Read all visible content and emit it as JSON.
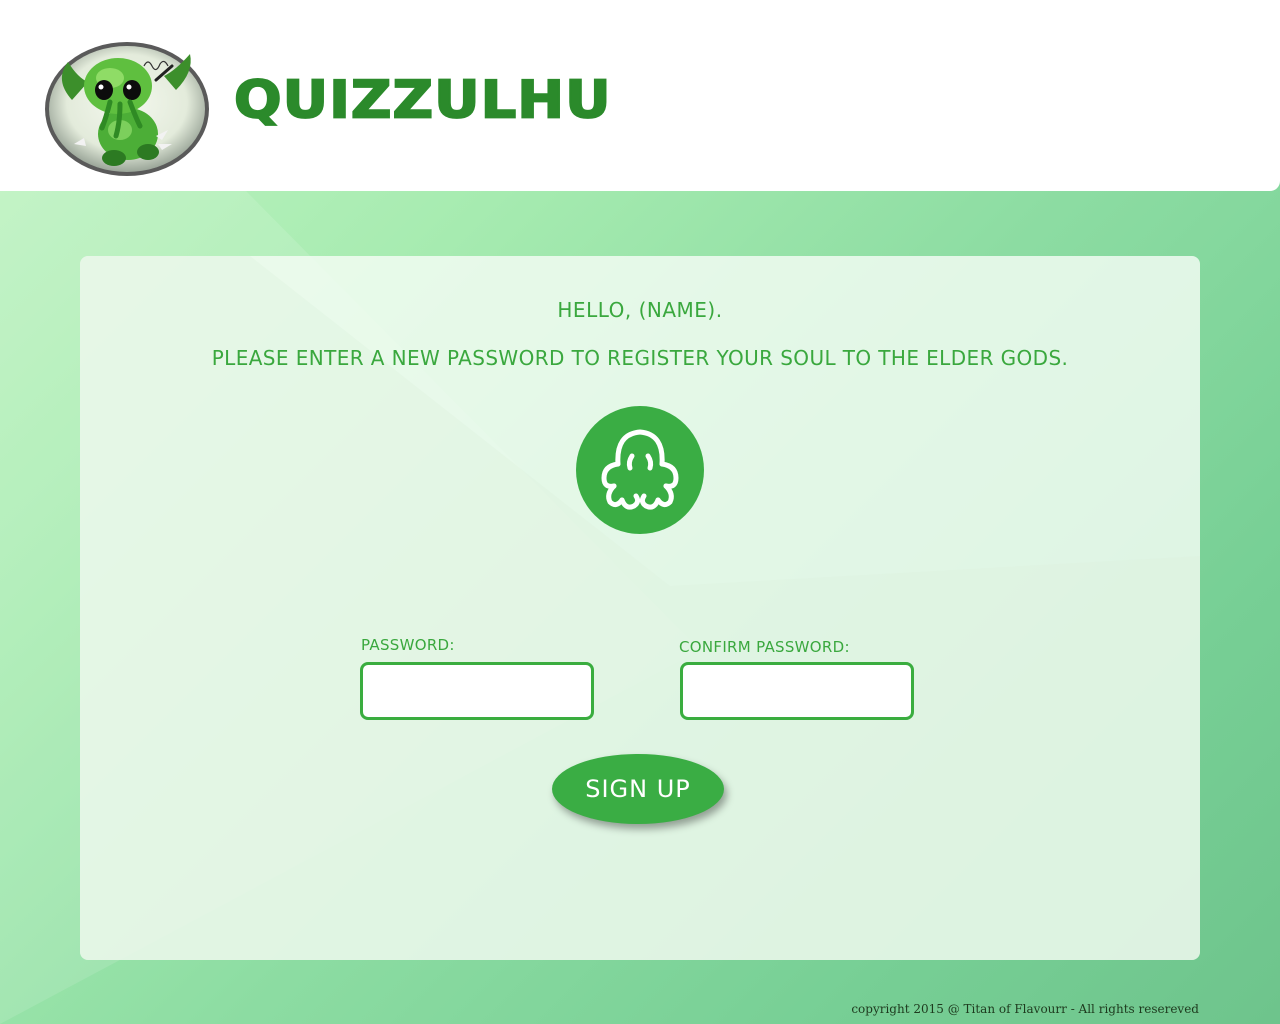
{
  "header": {
    "brand": "QUIZZULHU",
    "logo_icon": "cthulhu-mascot-icon"
  },
  "form": {
    "greeting": "HELLO, (NAME).",
    "instruction": "PLEASE ENTER A NEW PASSWORD TO REGISTER YOUR SOUL TO THE ELDER GODS.",
    "emblem_icon": "octopus-icon",
    "password": {
      "label": "PASSWORD:",
      "value": "",
      "placeholder": ""
    },
    "confirm_password": {
      "label": "CONFIRM PASSWORD:",
      "value": "",
      "placeholder": ""
    },
    "submit_label": "SIGN UP"
  },
  "footer": {
    "copyright": "copyright 2015 @ Titan of Flavourr - All rights resereved"
  },
  "colors": {
    "accent": "#3aad44",
    "brand_text": "#2b8a2b",
    "label_text": "#3aa83e"
  }
}
